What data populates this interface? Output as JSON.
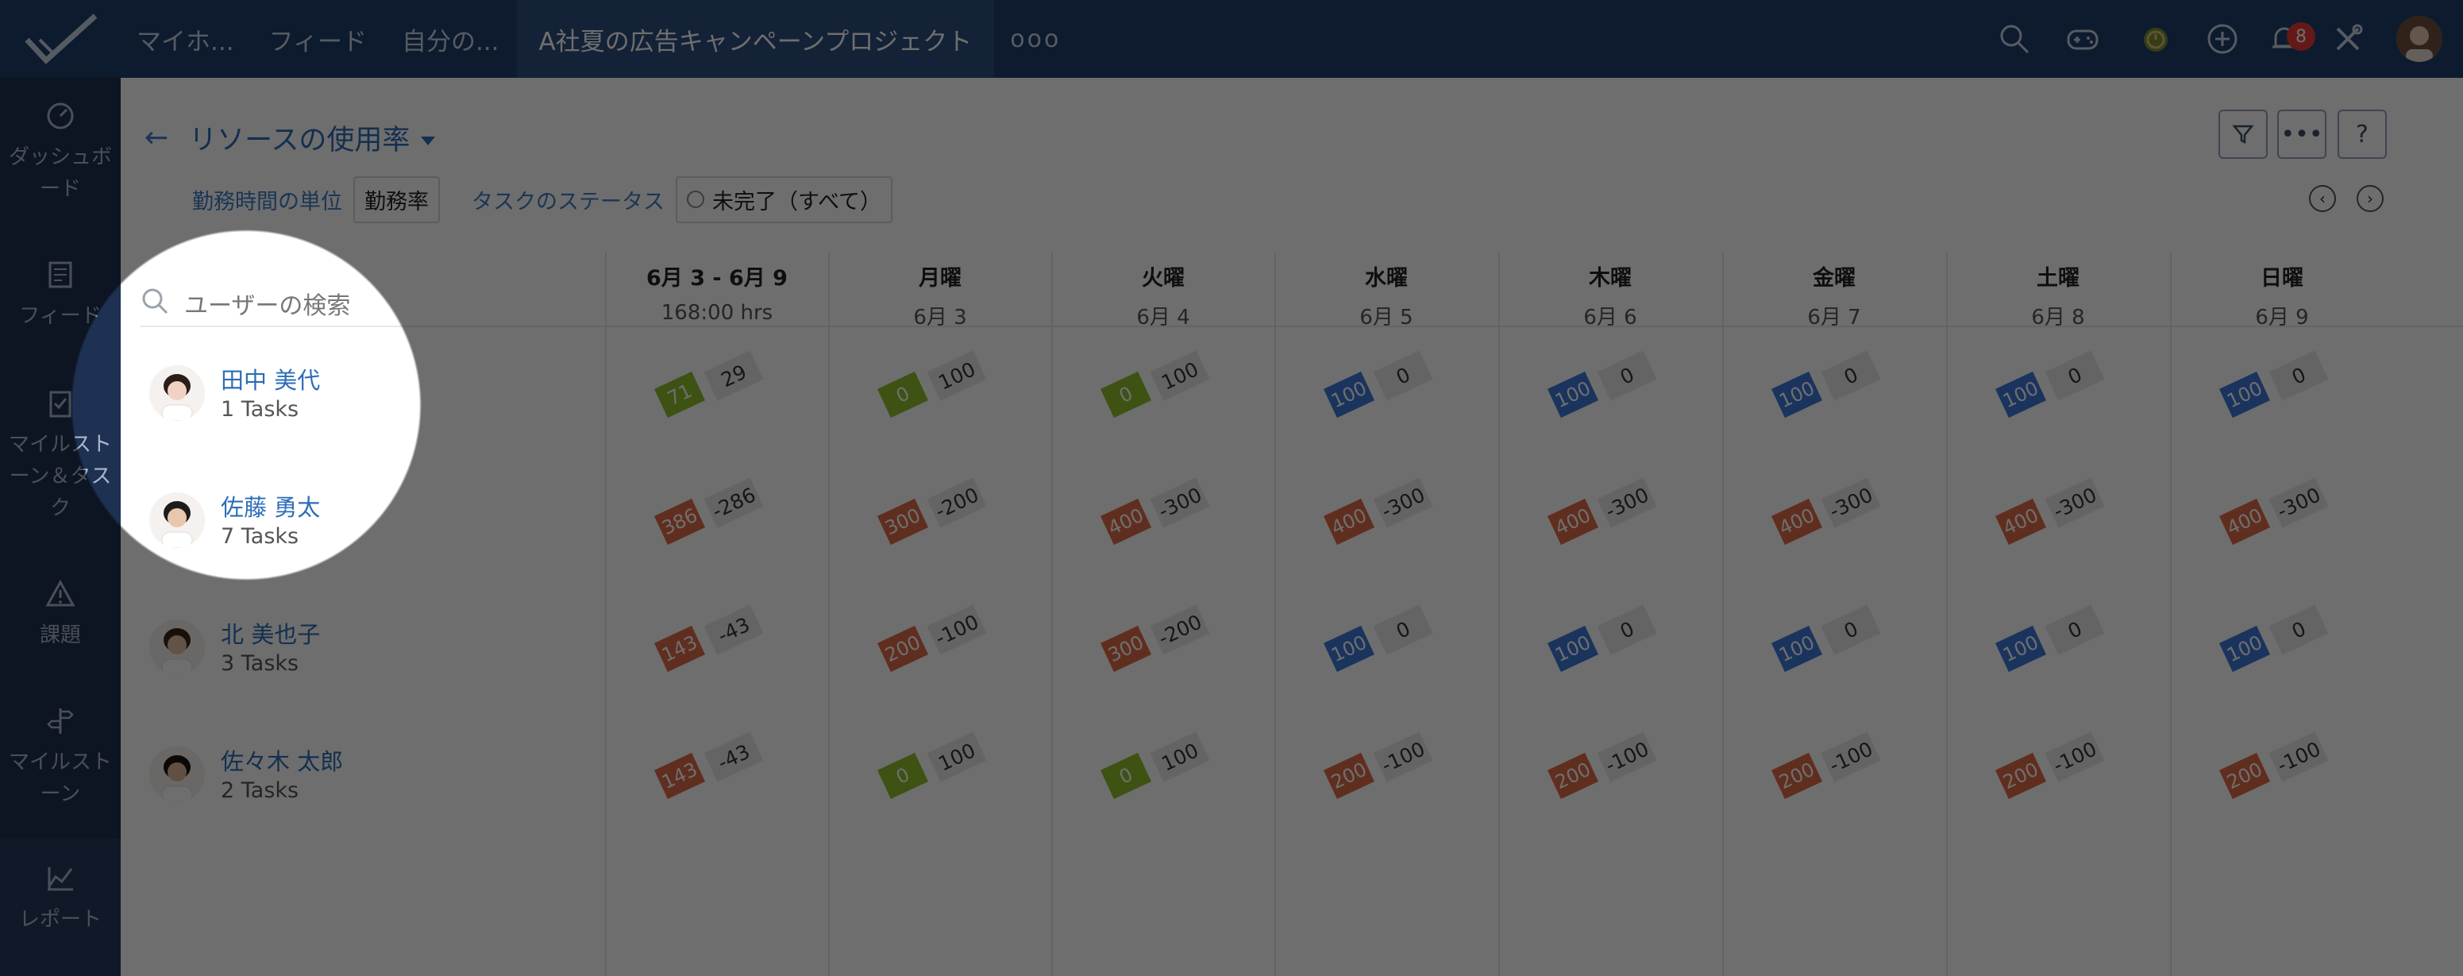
{
  "topbar": {
    "nav": [
      {
        "label": "マイホ..."
      },
      {
        "label": "フィード"
      },
      {
        "label": "自分の..."
      },
      {
        "label": "A社夏の広告キャンペーンプロジェクト"
      }
    ],
    "more": "ooo",
    "icons": [
      "search-icon",
      "gamepad-icon",
      "timer-icon",
      "add-icon",
      "bell-icon",
      "tools-icon"
    ],
    "notification_count": "8",
    "colors": {
      "background": "#1f3f6c",
      "active_tab": "#2d4f80",
      "badge": "#e53935"
    }
  },
  "sidebar": {
    "items": [
      {
        "label": "ダッシュボ ード",
        "icon": "gauge-icon"
      },
      {
        "label": "フィード",
        "icon": "feed-icon"
      },
      {
        "label": "マイルスト ーン＆タス ク",
        "icon": "milestone-task-icon"
      },
      {
        "label": "課題",
        "icon": "warning-icon"
      },
      {
        "label": "マイルスト ーン",
        "icon": "signpost-icon"
      },
      {
        "label": "レポート",
        "icon": "report-chart-icon"
      }
    ]
  },
  "main": {
    "back": "←",
    "title": "リソースの使用率",
    "toolbar": {
      "filter_icon": "filter-icon",
      "more": "•••",
      "help": "?"
    },
    "filters": {
      "unit_label": "勤務時間の単位",
      "unit_value": "勤務率",
      "status_label": "タスクのステータス",
      "status_value": "未完了（すべて）"
    },
    "search": {
      "placeholder": "ユーザーの検索"
    },
    "columns": [
      {
        "title": "6月 3 - 6月 9",
        "sub": "168:00 hrs"
      },
      {
        "title": "月曜",
        "sub": "6月 3"
      },
      {
        "title": "火曜",
        "sub": "6月 4"
      },
      {
        "title": "水曜",
        "sub": "6月 5"
      },
      {
        "title": "木曜",
        "sub": "6月 6"
      },
      {
        "title": "金曜",
        "sub": "6月 7"
      },
      {
        "title": "土曜",
        "sub": "6月 8"
      },
      {
        "title": "日曜",
        "sub": "6月 9"
      }
    ],
    "users": [
      {
        "name": "田中 美代",
        "tasks": "1 Tasks",
        "cells": [
          [
            "71",
            "29",
            "green"
          ],
          [
            "0",
            "100",
            "green"
          ],
          [
            "0",
            "100",
            "green"
          ],
          [
            "100",
            "0",
            "blue"
          ],
          [
            "100",
            "0",
            "blue"
          ],
          [
            "100",
            "0",
            "blue"
          ],
          [
            "100",
            "0",
            "blue"
          ],
          [
            "100",
            "0",
            "blue"
          ]
        ]
      },
      {
        "name": "佐藤 勇太",
        "tasks": "7 Tasks",
        "cells": [
          [
            "386",
            "-286",
            "red"
          ],
          [
            "300",
            "-200",
            "red"
          ],
          [
            "400",
            "-300",
            "red"
          ],
          [
            "400",
            "-300",
            "red"
          ],
          [
            "400",
            "-300",
            "red"
          ],
          [
            "400",
            "-300",
            "red"
          ],
          [
            "400",
            "-300",
            "red"
          ],
          [
            "400",
            "-300",
            "red"
          ]
        ]
      },
      {
        "name": "北 美也子",
        "tasks": "3 Tasks",
        "cells": [
          [
            "143",
            "-43",
            "red"
          ],
          [
            "200",
            "-100",
            "red"
          ],
          [
            "300",
            "-200",
            "red"
          ],
          [
            "100",
            "0",
            "blue"
          ],
          [
            "100",
            "0",
            "blue"
          ],
          [
            "100",
            "0",
            "blue"
          ],
          [
            "100",
            "0",
            "blue"
          ],
          [
            "100",
            "0",
            "blue"
          ]
        ]
      },
      {
        "name": "佐々木 太郎",
        "tasks": "2 Tasks",
        "cells": [
          [
            "143",
            "-43",
            "red"
          ],
          [
            "0",
            "100",
            "green"
          ],
          [
            "0",
            "100",
            "green"
          ],
          [
            "200",
            "-100",
            "red"
          ],
          [
            "200",
            "-100",
            "red"
          ],
          [
            "200",
            "-100",
            "red"
          ],
          [
            "200",
            "-100",
            "red"
          ],
          [
            "200",
            "-100",
            "red"
          ]
        ]
      }
    ],
    "colors": {
      "link": "#2d6db8",
      "green": "#8ebf2b",
      "blue": "#3b78d8",
      "red": "#de6b47"
    }
  }
}
